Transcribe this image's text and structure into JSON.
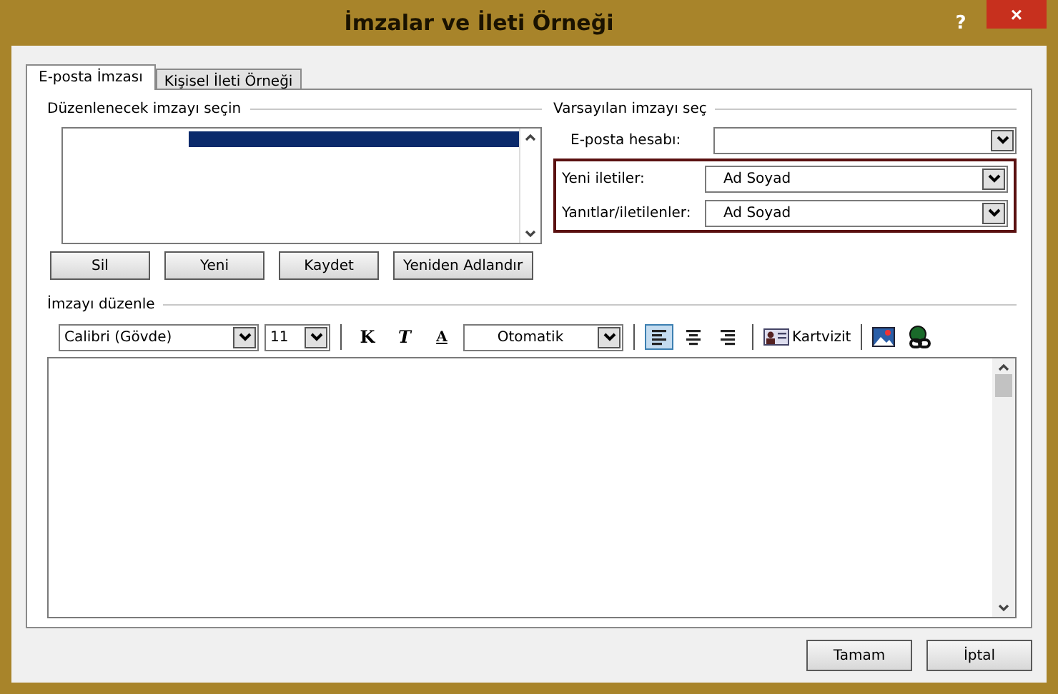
{
  "window": {
    "title": "İmzalar ve İleti Örneği",
    "help": "?",
    "close": "×"
  },
  "tabs": [
    {
      "label": "E-posta İmzası",
      "selected": true
    },
    {
      "label": "Kişisel İleti Örneği",
      "selected": false
    }
  ],
  "select_section": {
    "title": "Düzenlenecek imzayı seçin",
    "items": [
      {
        "selected": true
      }
    ],
    "buttons": [
      "Sil",
      "Yeni",
      "Kaydet",
      "Yeniden Adlandır"
    ]
  },
  "default_section": {
    "title": "Varsayılan imzayı seç",
    "fields": [
      {
        "label": "E-posta hesabı:",
        "highlighted": false
      },
      {
        "label": "Yeni iletiler:",
        "value": "Ad Soyad",
        "highlighted": true
      },
      {
        "label": "Yanıtlar/iletilenler:",
        "value": "Ad Soyad",
        "highlighted": true
      }
    ]
  },
  "edit_section": {
    "title": "İmzayı düzenle",
    "font": "Calibri (Gövde)",
    "size": "11",
    "format_buttons": [
      {
        "label": "K",
        "kind": "bold"
      },
      {
        "label": "T",
        "kind": "italic"
      },
      {
        "label": "A",
        "kind": "underline"
      }
    ],
    "color_label": "Otomatik",
    "align_buttons": [
      {
        "kind": "left",
        "selected": true
      },
      {
        "kind": "center",
        "selected": false
      },
      {
        "kind": "right",
        "selected": false
      }
    ],
    "card_button": "Kartvizit"
  },
  "footer_buttons": [
    "Tamam",
    "İptal"
  ]
}
